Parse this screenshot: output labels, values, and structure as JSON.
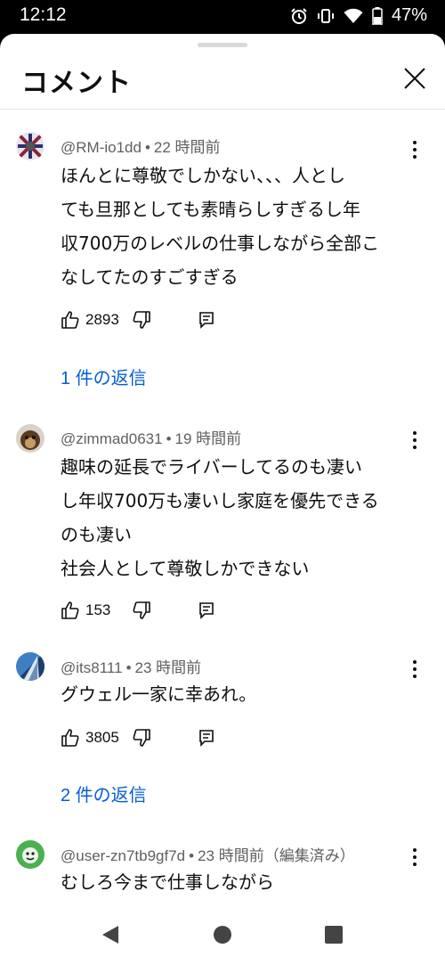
{
  "status_bar": {
    "time": "12:12",
    "battery": "47%"
  },
  "sheet": {
    "title": "コメント"
  },
  "comments": [
    {
      "author": "@RM-io1dd",
      "time": "22 時間前",
      "lines": [
        "ほんとに尊敬でしかない、、、人とし",
        "ても旦那としても素晴らしすぎるし年",
        "収700万のレベルの仕事しながら全部こ",
        "なしてたのすごすぎる"
      ],
      "likes": "2893",
      "replies": "1 件の返信"
    },
    {
      "author": "@zimmad0631",
      "time": "19 時間前",
      "lines": [
        "趣味の延長でライバーしてるのも凄い",
        "し年収700万も凄いし家庭を優先できる",
        "のも凄い",
        "社会人として尊敬しかできない"
      ],
      "likes": "153"
    },
    {
      "author": "@its8111",
      "time": "23 時間前",
      "lines": [
        "グウェル一家に幸あれ。"
      ],
      "likes": "3805",
      "replies": "2 件の返信"
    },
    {
      "author": "@user-zn7tb9gf7d",
      "time": "23 時間前（編集済み）",
      "lines": [
        "むしろ今まで仕事しながら"
      ]
    }
  ]
}
